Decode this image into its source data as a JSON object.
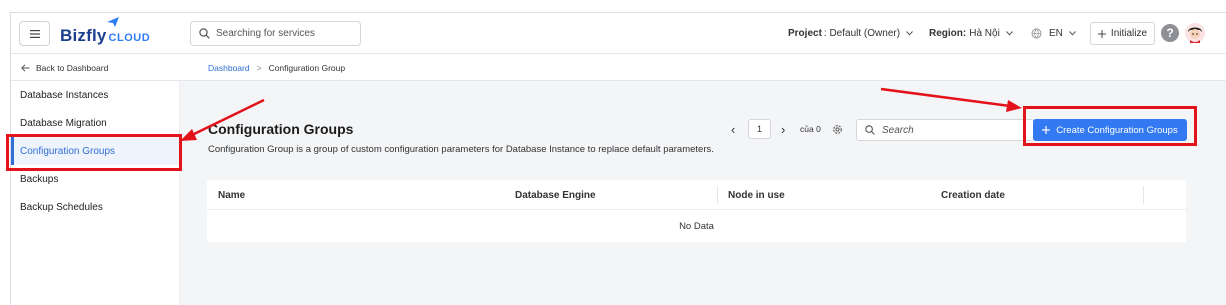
{
  "header": {
    "logo_main": "Bizfly",
    "logo_sub": "CLOUD",
    "search_placeholder": "Searching for services",
    "project_label": "Project",
    "project_value": ": Default (Owner)",
    "region_label": "Region:",
    "region_value": "Hà Nội",
    "language": "EN",
    "initialize_label": "Initialize",
    "help_label": "?"
  },
  "subbar": {
    "back_label": "Back to Dashboard",
    "breadcrumb": {
      "root": "Dashboard",
      "separator": ">",
      "current": "Configuration Group"
    }
  },
  "sidebar": {
    "items": [
      {
        "label": "Database Instances",
        "active": false
      },
      {
        "label": "Database Migration",
        "active": false
      },
      {
        "label": "Configuration Groups",
        "active": true
      },
      {
        "label": "Backups",
        "active": false
      },
      {
        "label": "Backup Schedules",
        "active": false
      }
    ]
  },
  "main": {
    "title": "Configuration Groups",
    "description": "Configuration Group is a group of custom configuration parameters for Database Instance to replace default parameters.",
    "pagination": {
      "prev": "‹",
      "page": "1",
      "next": "›",
      "total": "của 0"
    },
    "search_placeholder": "Search",
    "create_button": "Create Configuration Groups",
    "table": {
      "columns": [
        "Name",
        "Database Engine",
        "Node in use",
        "Creation date"
      ],
      "empty_text": "No Data"
    }
  },
  "colors": {
    "accent": "#3379f2",
    "annotation": "#e3131b",
    "brand": "#1d3f8f"
  }
}
